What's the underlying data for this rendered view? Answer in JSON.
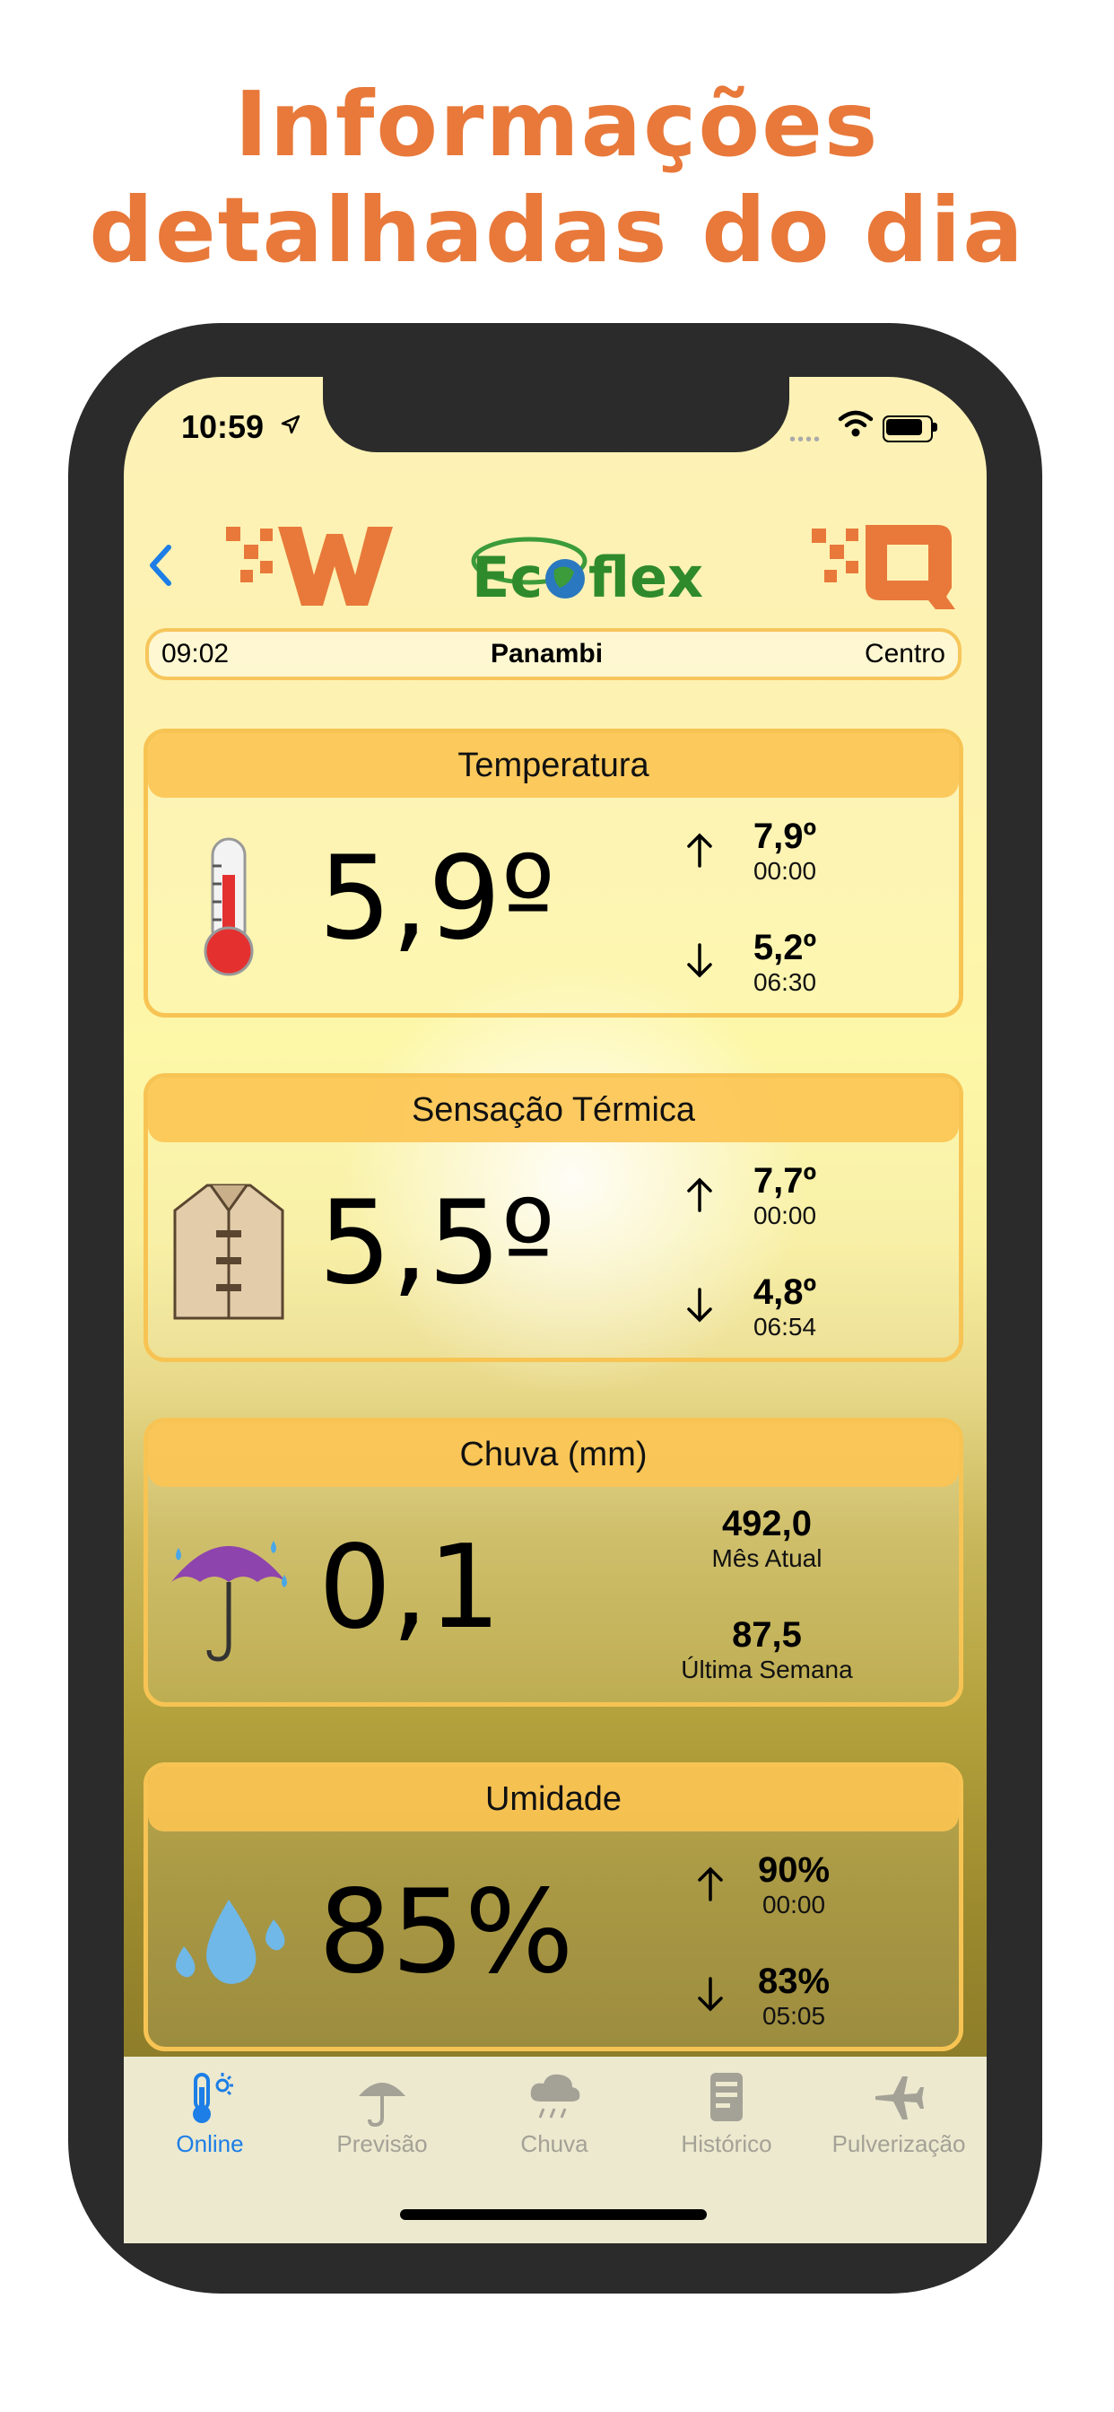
{
  "headline": {
    "line1": "Informações",
    "line2": "detalhadas do dia"
  },
  "status_bar": {
    "time": "10:59",
    "location_icon": "location-arrow-icon"
  },
  "header": {
    "back_icon": "chevron-left-icon",
    "logo_left": "W logo",
    "logo_center": "Ecoflex",
    "logo_right": "Q logo"
  },
  "info_bar": {
    "time": "09:02",
    "city": "Panambi",
    "region": "Centro"
  },
  "cards": {
    "temperatura": {
      "title": "Temperatura",
      "value": "5,9º",
      "max": "7,9º",
      "max_time": "00:00",
      "min": "5,2º",
      "min_time": "06:30",
      "icon": "thermometer-icon"
    },
    "sensacao": {
      "title": "Sensação Térmica",
      "value": "5,5º",
      "max": "7,7º",
      "max_time": "00:00",
      "min": "4,8º",
      "min_time": "06:54",
      "icon": "coat-icon"
    },
    "chuva": {
      "title": "Chuva (mm)",
      "value": "0,1",
      "month_value": "492,0",
      "month_label": "Mês Atual",
      "week_value": "87,5",
      "week_label": "Última Semana",
      "icon": "umbrella-rain-icon"
    },
    "umidade": {
      "title": "Umidade",
      "value": "85%",
      "max": "90%",
      "max_time": "00:00",
      "min": "83%",
      "min_time": "05:05",
      "icon": "water-drops-icon"
    }
  },
  "tabs": [
    {
      "label": "Online",
      "icon": "thermometer-sun-icon",
      "active": true
    },
    {
      "label": "Previsão",
      "icon": "umbrella-icon",
      "active": false
    },
    {
      "label": "Chuva",
      "icon": "rain-cloud-icon",
      "active": false
    },
    {
      "label": "Histórico",
      "icon": "document-icon",
      "active": false
    },
    {
      "label": "Pulverização",
      "icon": "airplane-icon",
      "active": false
    }
  ],
  "colors": {
    "accent": "#E8793A",
    "card_border": "#f7c454",
    "tab_active": "#1c7ee6",
    "tab_inactive": "#a4a196"
  }
}
